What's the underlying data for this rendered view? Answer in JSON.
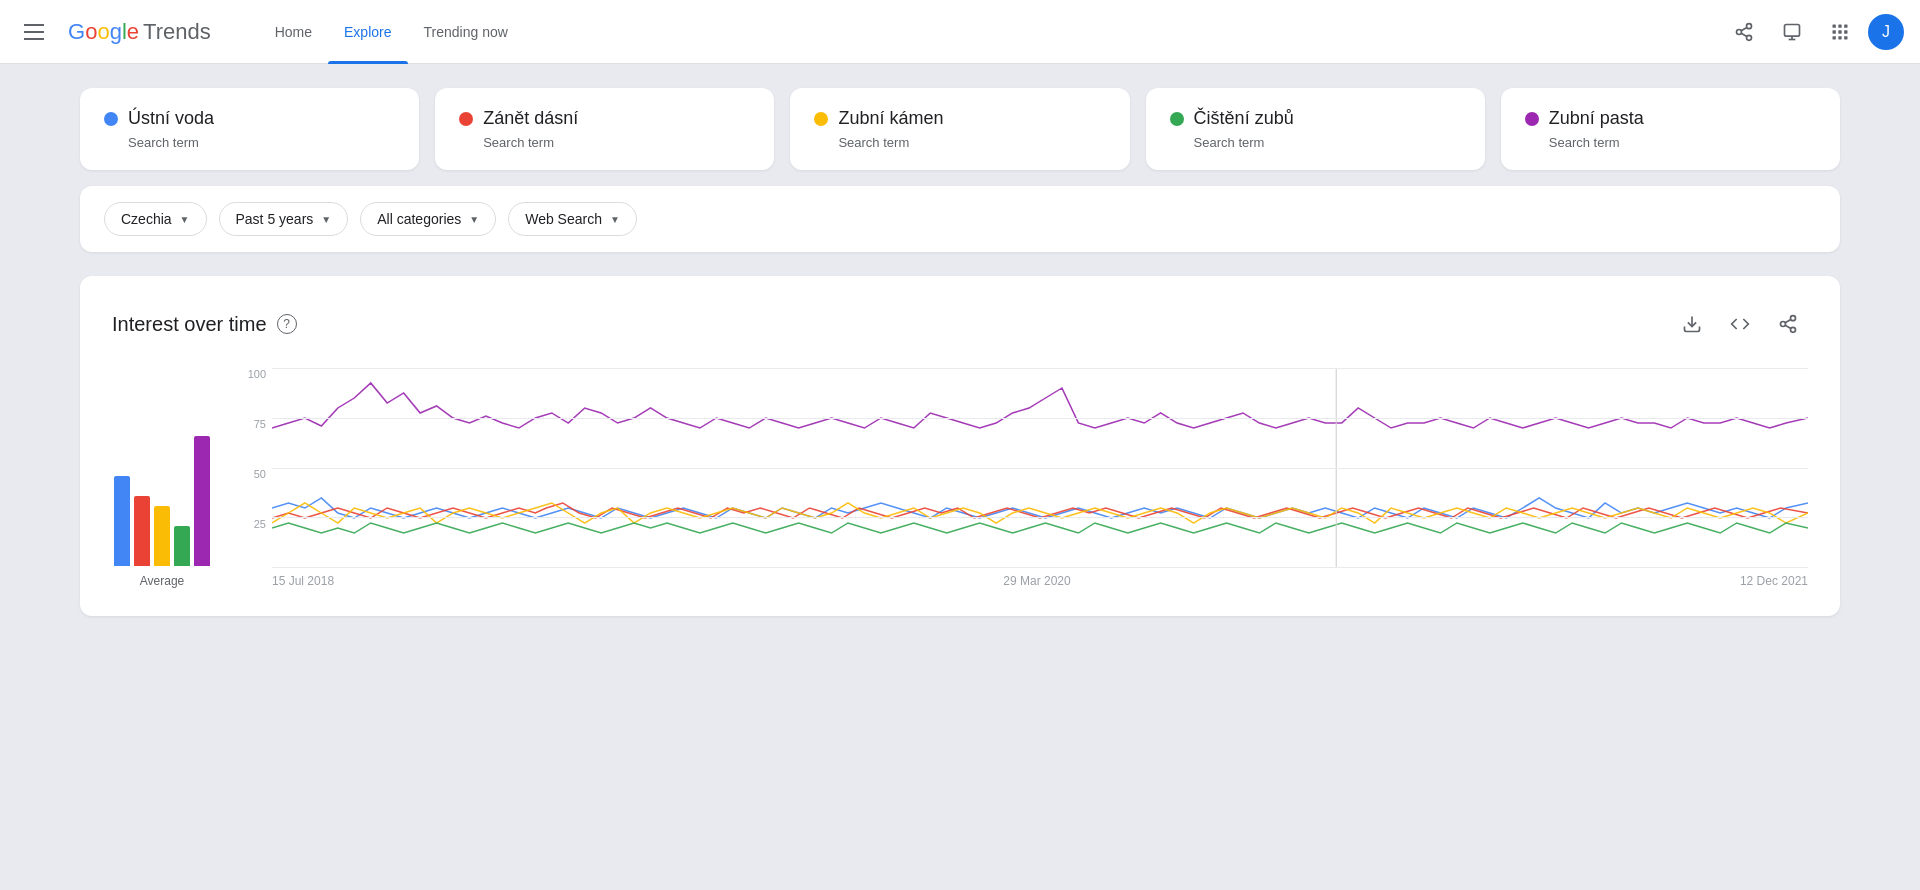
{
  "header": {
    "menu_icon": "☰",
    "logo_text": "Google Trends",
    "nav": [
      {
        "label": "Home",
        "active": false
      },
      {
        "label": "Explore",
        "active": true
      },
      {
        "label": "Trending now",
        "active": false
      }
    ],
    "share_icon": "share",
    "feedback_icon": "feedback",
    "apps_icon": "apps",
    "avatar_letter": "J"
  },
  "search_terms": [
    {
      "label": "Ústní voda",
      "subtitle": "Search term",
      "color": "#4285f4"
    },
    {
      "label": "Zánět dásní",
      "subtitle": "Search term",
      "color": "#ea4335"
    },
    {
      "label": "Zubní kámen",
      "subtitle": "Search term",
      "color": "#fbbc05"
    },
    {
      "label": "Čištění zubů",
      "subtitle": "Search term",
      "color": "#34a853"
    },
    {
      "label": "Zubní pasta",
      "subtitle": "Search term",
      "color": "#9c27b0"
    }
  ],
  "filters": [
    {
      "label": "Czechia",
      "id": "filter-country"
    },
    {
      "label": "Past 5 years",
      "id": "filter-time"
    },
    {
      "label": "All categories",
      "id": "filter-category"
    },
    {
      "label": "Web Search",
      "id": "filter-type"
    }
  ],
  "chart": {
    "title": "Interest over time",
    "help_label": "?",
    "download_label": "⬇",
    "embed_label": "<>",
    "share_label": "⋈",
    "y_labels": [
      "100",
      "75",
      "50",
      "25"
    ],
    "x_labels": [
      "15 Jul 2018",
      "29 Mar 2020",
      "12 Dec 2021"
    ],
    "avg_label": "Average",
    "avg_bars": [
      {
        "color": "#4285f4",
        "height": 90
      },
      {
        "color": "#ea4335",
        "height": 70
      },
      {
        "color": "#fbbc05",
        "height": 60
      },
      {
        "color": "#34a853",
        "height": 40
      },
      {
        "color": "#9c27b0",
        "height": 130
      }
    ]
  }
}
